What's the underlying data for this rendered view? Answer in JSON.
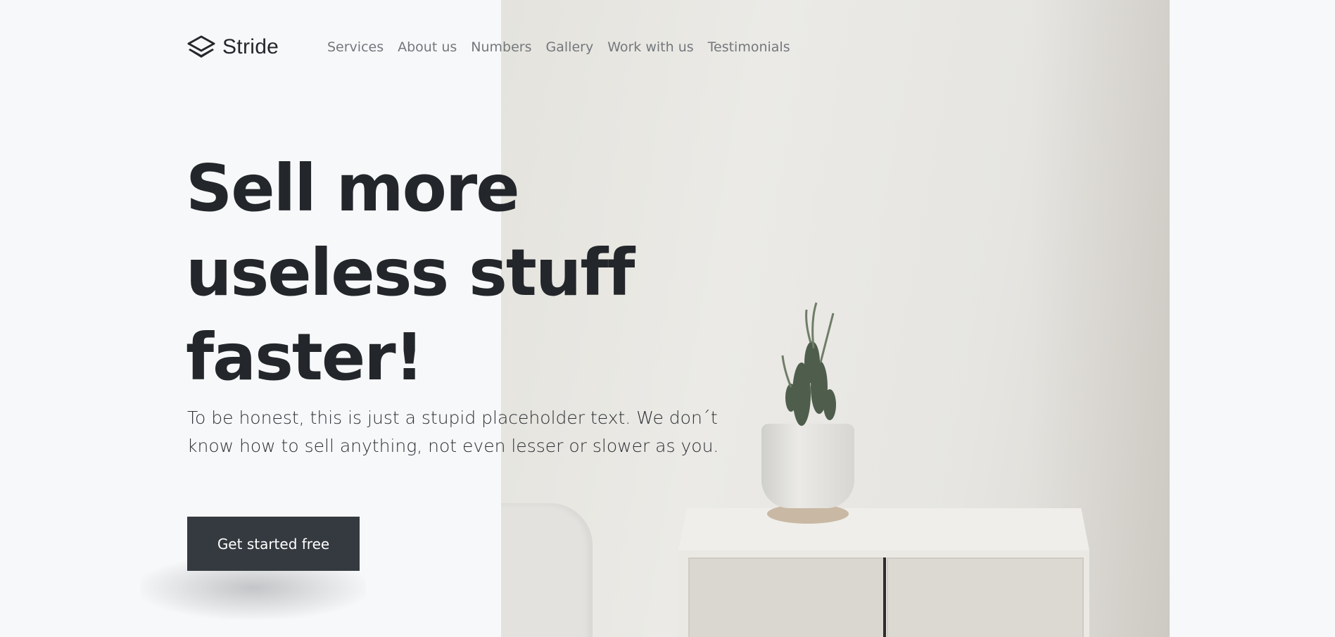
{
  "brand": {
    "name": "Stride",
    "logo_icon": "layers-icon"
  },
  "nav": {
    "items": [
      {
        "label": "Services"
      },
      {
        "label": "About us"
      },
      {
        "label": "Numbers"
      },
      {
        "label": "Gallery"
      },
      {
        "label": "Work with us"
      },
      {
        "label": "Testimonials"
      }
    ]
  },
  "hero": {
    "headline_lines": [
      "Sell more",
      "useless stuff",
      "faster!"
    ],
    "subtext": "To be honest, this is just a stupid placeholder text. We don´t know how to sell anything, not even lesser or slower as you.",
    "cta_label": "Get started free",
    "image_subject": "potted-cactus-on-white-cabinet"
  },
  "colors": {
    "background": "#f7f8f9",
    "text_dark": "#23262a",
    "nav_text": "#74777c",
    "button_bg": "#353a40",
    "button_text": "#ffffff"
  }
}
